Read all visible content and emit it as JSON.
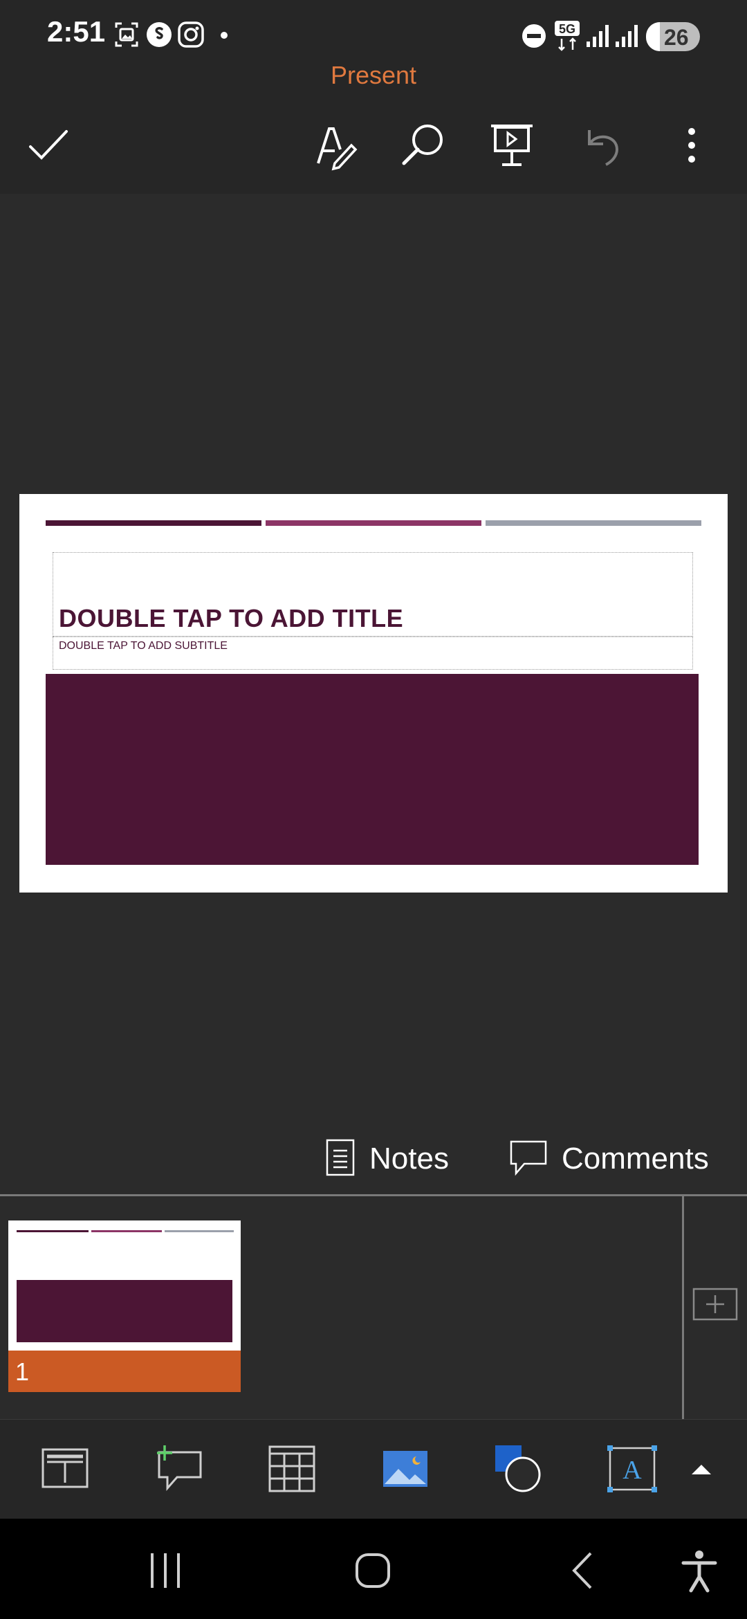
{
  "status_bar": {
    "time": "2:51",
    "battery_level": "26",
    "battery_fraction": 0.26,
    "icons": [
      "screenshot-icon",
      "shazam-icon",
      "instagram-icon",
      "dot-icon",
      "dnd-icon",
      "5g-icon",
      "signal-icon",
      "signal-icon",
      "battery-icon"
    ],
    "network_label": "5G"
  },
  "app_bar": {
    "title": "Present",
    "buttons": [
      "check-icon",
      "draw-icon",
      "search-icon",
      "present-icon",
      "undo-icon",
      "more-icon"
    ]
  },
  "slide": {
    "title": "DOUBLE TAP TO ADD TITLE",
    "subtitle": "DOUBLE TAP TO ADD SUBTITLE",
    "colors": {
      "line_1": "#4b1535",
      "line_2": "#8c3566",
      "line_3": "#9ba0ab",
      "band": "#4c1535"
    }
  },
  "footer_bar": {
    "notes_label": "Notes",
    "comments_label": "Comments"
  },
  "thumbnails": [
    {
      "number": "1",
      "selected": true,
      "selected_color": "#cb5a24"
    }
  ],
  "insert_bar": {
    "buttons": [
      "layout-icon",
      "new-comment-icon",
      "table-icon",
      "picture-icon",
      "shapes-icon",
      "textbox-icon",
      "expand-up-icon"
    ]
  },
  "nav_bar": {
    "buttons": [
      "recents-icon",
      "home-icon",
      "back-icon",
      "accessibility-icon"
    ]
  }
}
